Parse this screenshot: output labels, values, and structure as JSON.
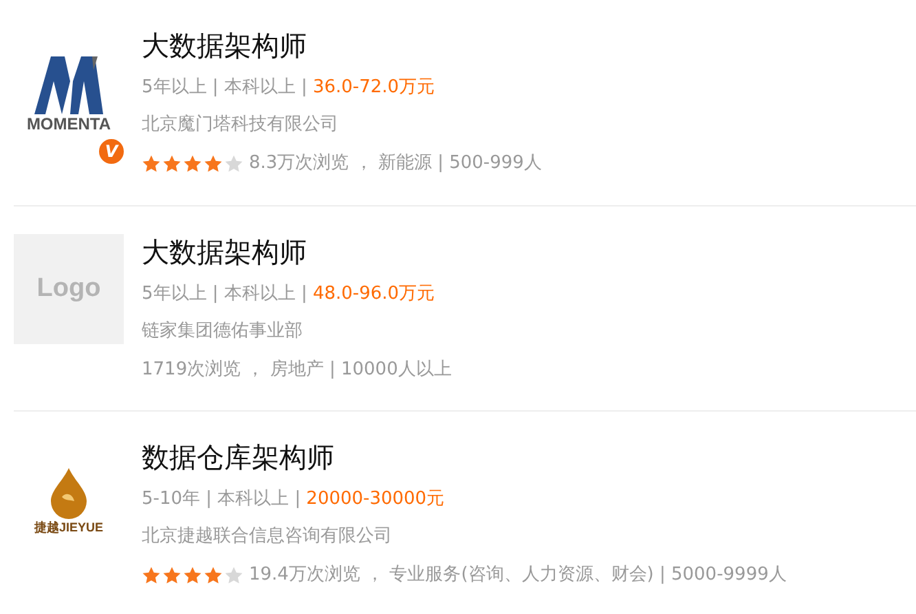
{
  "jobs": [
    {
      "logo": {
        "kind": "momenta",
        "text": "MOMENTA",
        "badge": "V"
      },
      "title": "大数据架构师",
      "requirements": "5年以上 | 本科以上 |",
      "salary": "36.0-72.0万元",
      "company": "北京魔门塔科技有限公司",
      "stars": 4,
      "meta": "8.3万次浏览 ， 新能源 | 500-999人"
    },
    {
      "logo": {
        "kind": "placeholder",
        "text": "Logo"
      },
      "title": "大数据架构师",
      "requirements": "5年以上 | 本科以上 |",
      "salary": "48.0-96.0万元",
      "company": "链家集团德佑事业部",
      "meta": "1719次浏览 ， 房地产 | 10000人以上"
    },
    {
      "logo": {
        "kind": "drop",
        "text": "捷越JIEYUE"
      },
      "title": "数据仓库架构师",
      "requirements": "5-10年 | 本科以上 |",
      "salary": "20000-30000元",
      "company": "北京捷越联合信息咨询有限公司",
      "stars": 4,
      "meta": "19.4万次浏览 ， 专业服务(咨询、人力资源、财会) | 5000-9999人"
    }
  ]
}
